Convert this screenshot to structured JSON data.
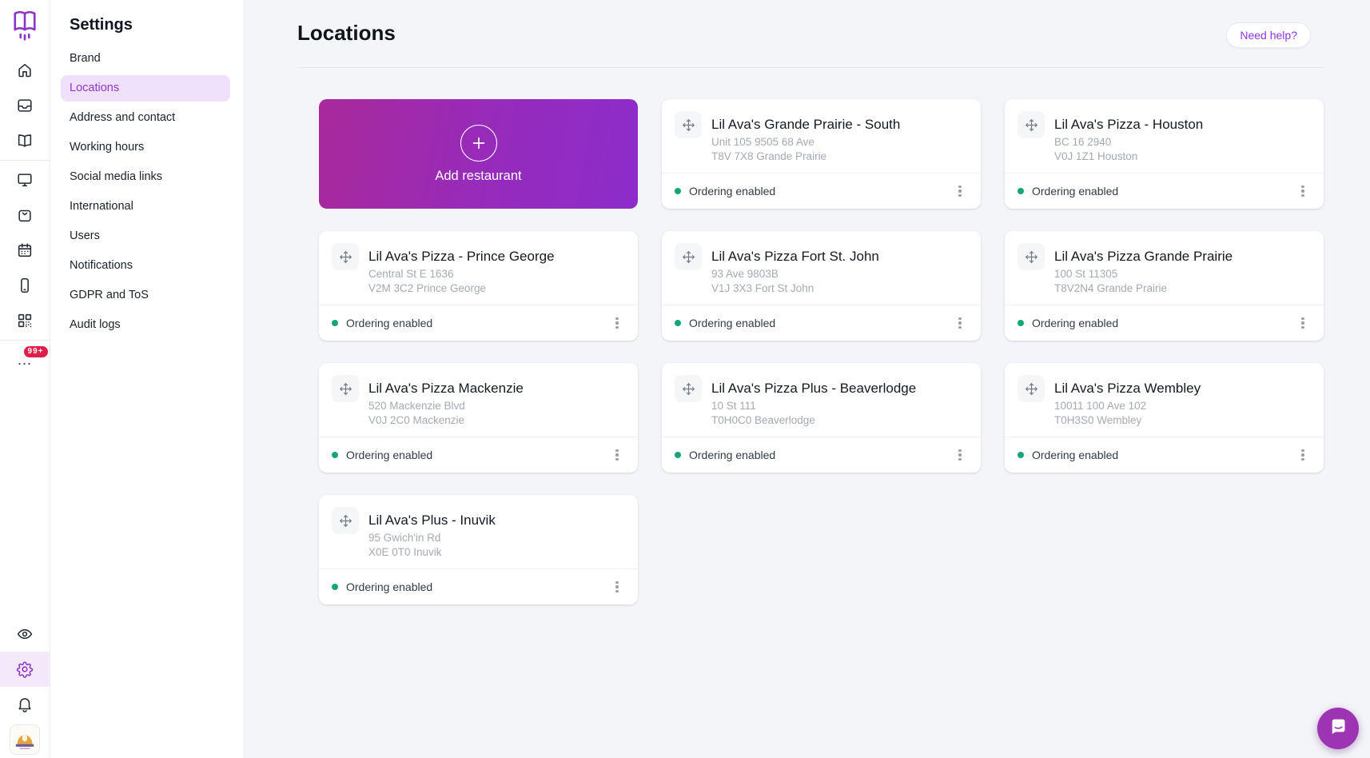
{
  "rail": {
    "logo_icon": "brand-logo-icon",
    "top_icons": [
      "home-icon",
      "inbox-icon",
      "menu-book-icon"
    ],
    "mid_icons": [
      "display-icon",
      "orders-bag-icon",
      "calendar-icon",
      "mobile-icon",
      "qr-code-icon"
    ],
    "more_label": "...",
    "more_badge": "99+",
    "bottom_icons": [
      "eye-icon",
      "gear-icon",
      "bell-icon"
    ],
    "avatar": "restaurant-brand-avatar"
  },
  "sidenav": {
    "title": "Settings",
    "items": [
      {
        "label": "Brand",
        "active": false
      },
      {
        "label": "Locations",
        "active": true
      },
      {
        "label": "Address and contact",
        "active": false
      },
      {
        "label": "Working hours",
        "active": false
      },
      {
        "label": "Social media links",
        "active": false
      },
      {
        "label": "International",
        "active": false
      },
      {
        "label": "Users",
        "active": false
      },
      {
        "label": "Notifications",
        "active": false
      },
      {
        "label": "GDPR and ToS",
        "active": false
      },
      {
        "label": "Audit logs",
        "active": false
      }
    ]
  },
  "header": {
    "title": "Locations",
    "help_button": "Need help?"
  },
  "add_card": {
    "label": "Add restaurant",
    "icon": "plus-circle-icon"
  },
  "locations": [
    {
      "name": "Lil Ava's Grande Prairie - South",
      "address1": "Unit 105 9505 68 Ave",
      "address2": "T8V 7X8 Grande Prairie",
      "status": "Ordering enabled"
    },
    {
      "name": "Lil Ava's Pizza - Houston",
      "address1": "BC 16 2940",
      "address2": "V0J 1Z1 Houston",
      "status": "Ordering enabled"
    },
    {
      "name": "Lil Ava's Pizza - Prince George",
      "address1": "Central St E 1636",
      "address2": "V2M 3C2 Prince George",
      "status": "Ordering enabled"
    },
    {
      "name": "Lil Ava's Pizza Fort St. John",
      "address1": "93 Ave 9803B",
      "address2": "V1J 3X3 Fort St John",
      "status": "Ordering enabled"
    },
    {
      "name": "Lil Ava's Pizza Grande Prairie",
      "address1": "100 St 11305",
      "address2": "T8V2N4 Grande Prairie",
      "status": "Ordering enabled"
    },
    {
      "name": "Lil Ava's Pizza Mackenzie",
      "address1": "520 Mackenzie Blvd",
      "address2": "V0J 2C0 Mackenzie",
      "status": "Ordering enabled"
    },
    {
      "name": "Lil Ava's Pizza Plus - Beaverlodge",
      "address1": "10 St 111",
      "address2": "T0H0C0 Beaverlodge",
      "status": "Ordering enabled"
    },
    {
      "name": "Lil Ava's Pizza Wembley",
      "address1": "10011 100 Ave 102",
      "address2": "T0H3S0 Wembley",
      "status": "Ordering enabled"
    },
    {
      "name": "Lil Ava's Plus - Inuvik",
      "address1": "95 Gwich'in Rd",
      "address2": "X0E 0T0 Inuvik",
      "status": "Ordering enabled"
    }
  ],
  "chat": {
    "launcher_icon": "chat-bubble-icon"
  },
  "colors": {
    "accent_purple": "#9333ea",
    "active_nav_bg": "#efe1fb",
    "active_nav_text": "#9233c9",
    "add_gradient_start": "#a9299b",
    "add_gradient_end": "#8d2ccb",
    "status_green": "#16a57b",
    "badge_red": "#e11d48",
    "chat_purple": "#9c34b4",
    "page_bg": "#f4f5f9"
  }
}
